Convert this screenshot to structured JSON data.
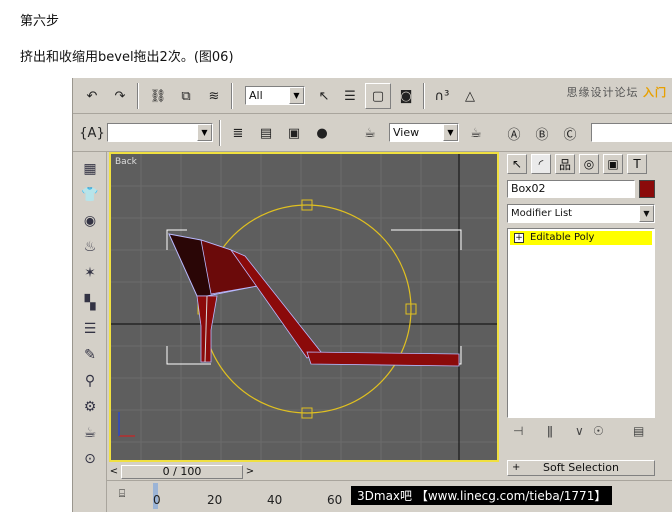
{
  "article": {
    "step_title": "第六步",
    "description": "挤出和收缩用bevel拖出2次。(图06)"
  },
  "toolbar": {
    "selection_filter": "All",
    "view_dropdown": "View",
    "watermark_text": "思缘设计论坛",
    "watermark_brand": "入门"
  },
  "viewport": {
    "label": "Back"
  },
  "command_panel": {
    "object_name": "Box02",
    "object_color": "#8b0a0a",
    "modifier_list_label": "Modifier List",
    "stack_item": "Editable Poly",
    "rollout_label": "Soft Selection",
    "rollout_plus": "+"
  },
  "time_slider": {
    "frame_display": "0 / 100",
    "prev_arrow": "<",
    "next_arrow": ">"
  },
  "ruler": {
    "ticks": [
      "0",
      "20",
      "40",
      "60"
    ]
  },
  "watermark": {
    "text": "3Dmax吧 【www.linecg.com/tieba/1771】"
  },
  "colors": {
    "ui_gray": "#d4d0c8",
    "viewport_bg": "#5e5e5e",
    "active_border": "#f0e040",
    "model_red": "#8b0a0a",
    "highlight_yellow": "#ffff00"
  }
}
